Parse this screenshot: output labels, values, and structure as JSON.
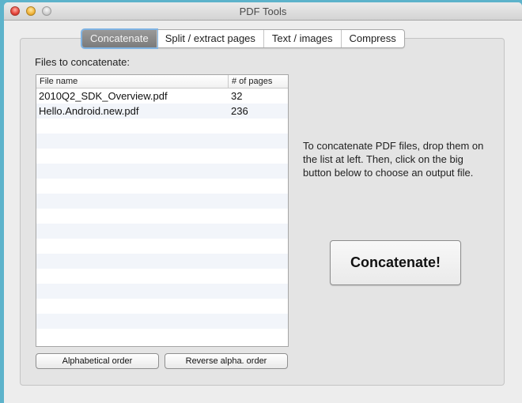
{
  "window": {
    "title": "PDF Tools"
  },
  "tabs": [
    {
      "label": "Concatenate",
      "active": true
    },
    {
      "label": "Split / extract pages",
      "active": false
    },
    {
      "label": "Text / images",
      "active": false
    },
    {
      "label": "Compress",
      "active": false
    }
  ],
  "concatenate": {
    "files_label": "Files to concatenate:",
    "table": {
      "columns": [
        "File name",
        "# of pages"
      ],
      "rows": [
        {
          "name": "2010Q2_SDK_Overview.pdf",
          "pages": "32"
        },
        {
          "name": "Hello.Android.new.pdf",
          "pages": "236"
        }
      ]
    },
    "alpha_button": "Alphabetical order",
    "reverse_button": "Reverse alpha. order",
    "info_text": "To concatenate PDF files, drop them on the list at left. Then, click on the big button below to choose an output file.",
    "concatenate_button": "Concatenate!"
  }
}
